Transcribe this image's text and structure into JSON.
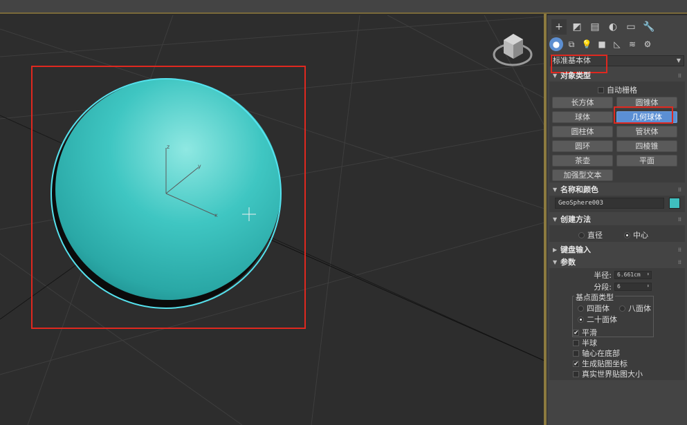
{
  "window": {
    "top_bar": ""
  },
  "colors": {
    "sphere": "#3fc2c2",
    "accent": "#5b8fd4",
    "annotation": "#e0281f",
    "object_color": "#3fbfbf"
  },
  "command_panel": {
    "tabs": [
      {
        "icon": "plus-icon",
        "glyph": "+"
      },
      {
        "icon": "modify-icon",
        "glyph": "◩"
      },
      {
        "icon": "hierarchy-icon",
        "glyph": "▤"
      },
      {
        "icon": "motion-icon",
        "glyph": "◐"
      },
      {
        "icon": "display-icon",
        "glyph": "▭"
      },
      {
        "icon": "utilities-icon",
        "glyph": "🔧"
      }
    ],
    "subtabs": [
      {
        "icon": "geometry-icon",
        "glyph": "●"
      },
      {
        "icon": "shapes-icon",
        "glyph": "⧉"
      },
      {
        "icon": "lights-icon",
        "glyph": "💡"
      },
      {
        "icon": "cameras-icon",
        "glyph": "■"
      },
      {
        "icon": "helpers-icon",
        "glyph": "◺"
      },
      {
        "icon": "spacewarps-icon",
        "glyph": "≋"
      },
      {
        "icon": "systems-icon",
        "glyph": "⚙"
      }
    ],
    "category": "标准基本体",
    "object_type": {
      "title": "对象类型",
      "auto_grid": "自动栅格",
      "buttons": [
        "长方体",
        "圆锥体",
        "球体",
        "几何球体",
        "圆柱体",
        "管状体",
        "圆环",
        "四棱锥",
        "茶壶",
        "平面",
        "加强型文本"
      ]
    },
    "name_color": {
      "title": "名称和颜色",
      "name": "GeoSphere003"
    },
    "creation_method": {
      "title": "创建方法",
      "options": [
        "直径",
        "中心"
      ]
    },
    "keyboard_entry": {
      "title": "键盘输入"
    },
    "parameters": {
      "title": "参数",
      "radius_label": "半径:",
      "radius_value": "6.661cm",
      "segments_label": "分段:",
      "segments_value": "6",
      "base_type_title": "基点面类型",
      "base_types": [
        "四面体",
        "八面体",
        "二十面体"
      ],
      "options": [
        {
          "label": "平滑",
          "checked": true
        },
        {
          "label": "半球",
          "checked": false
        },
        {
          "label": "轴心在底部",
          "checked": false
        },
        {
          "label": "生成贴图坐标",
          "checked": true
        },
        {
          "label": "真实世界贴图大小",
          "checked": false
        }
      ]
    }
  },
  "viewport": {
    "axis_labels": {
      "z": "z",
      "y": "y",
      "x": "x"
    }
  }
}
